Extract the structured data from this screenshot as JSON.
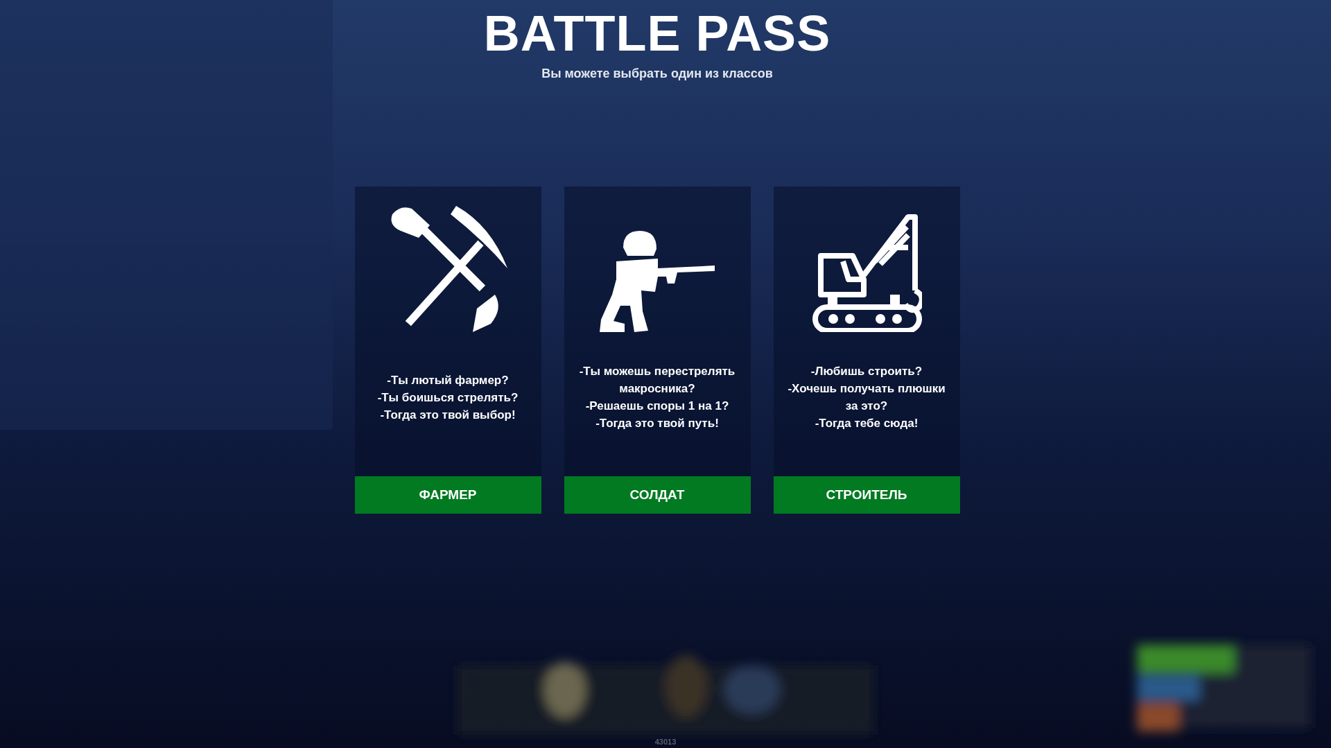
{
  "header": {
    "title": "BATTLE PASS",
    "subtitle": "Вы можете выбрать один из классов"
  },
  "classes": [
    {
      "kind": "farmer",
      "lines": [
        "-Ты лютый фармер?",
        "-Ты боишься стрелять?",
        "-Тогда это твой выбор!"
      ],
      "button": "ФАРМЕР"
    },
    {
      "kind": "soldier",
      "lines": [
        "-Ты можешь перестрелять макросника?",
        "-Решаешь споры 1 на 1?",
        "-Тогда это твой путь!"
      ],
      "button": "СОЛДАТ"
    },
    {
      "kind": "builder",
      "lines": [
        "-Любишь строить?",
        "-Хочешь получать плюшки за это?",
        "-Тогда тебе сюда!"
      ],
      "button": "СТРОИТЕЛЬ"
    }
  ],
  "hud": {
    "counter": "43013"
  }
}
